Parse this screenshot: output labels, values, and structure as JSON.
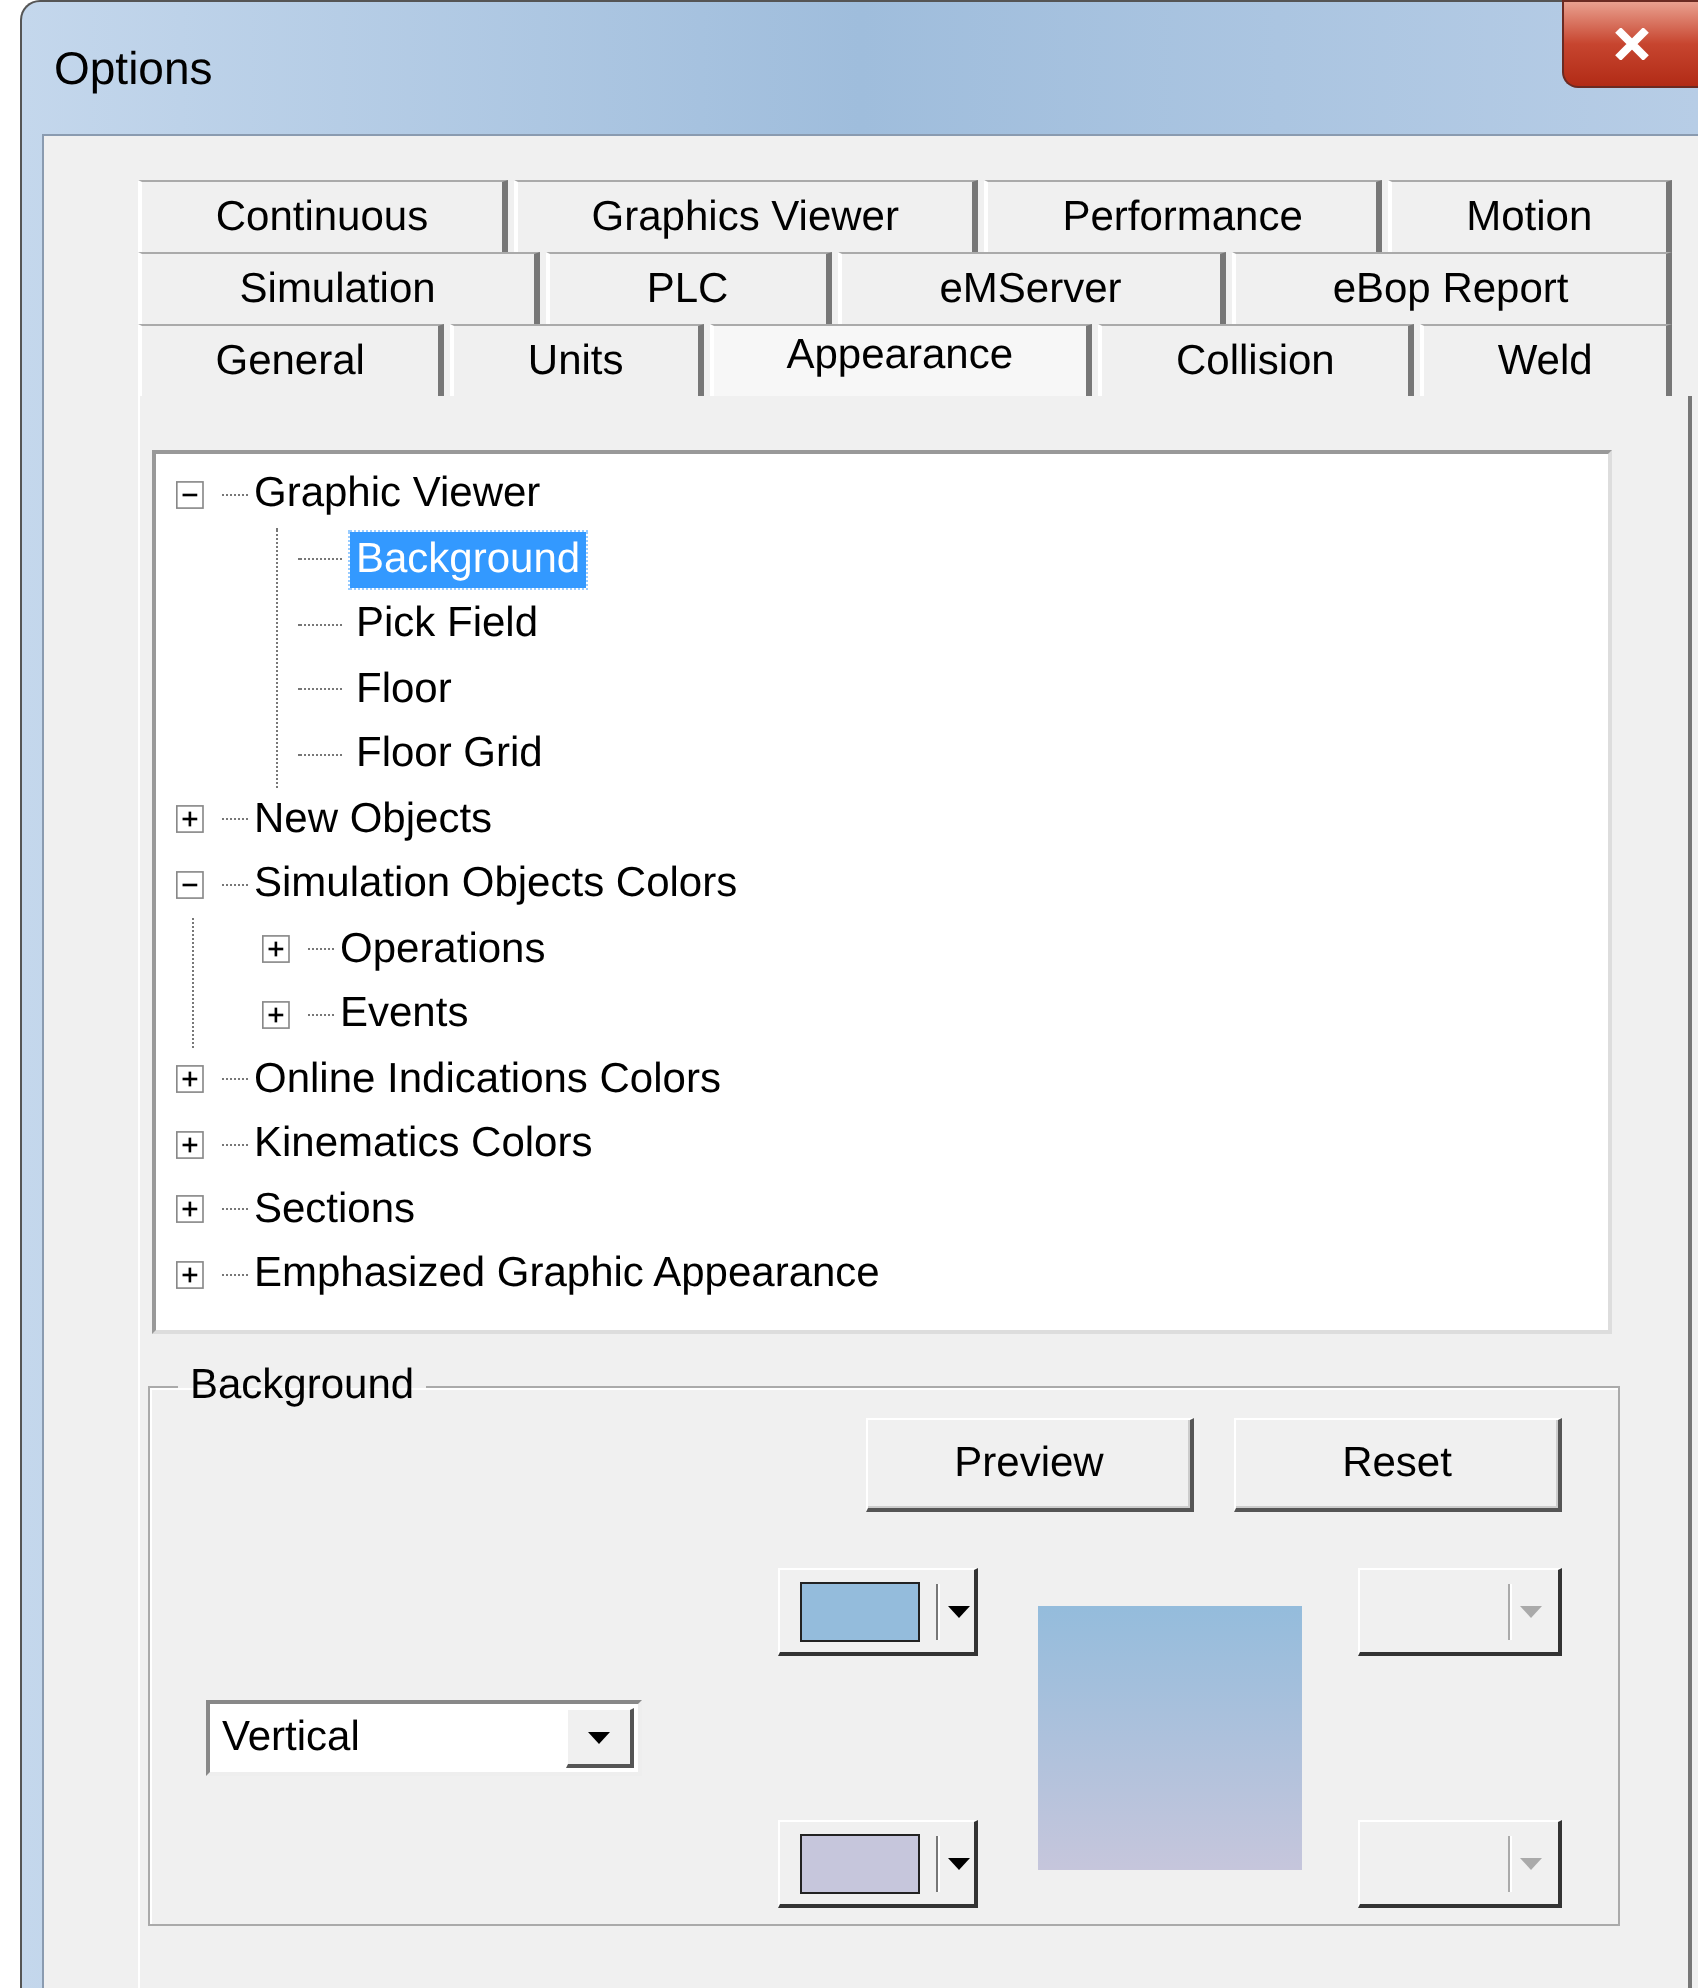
{
  "window": {
    "title": "Options"
  },
  "tab_rows": [
    [
      {
        "label": "Continuous",
        "selected": false
      },
      {
        "label": "Graphics Viewer",
        "selected": false
      },
      {
        "label": "Performance",
        "selected": false
      },
      {
        "label": "Motion",
        "selected": false
      }
    ],
    [
      {
        "label": "Simulation",
        "selected": false
      },
      {
        "label": "PLC",
        "selected": false
      },
      {
        "label": "eMServer",
        "selected": false
      },
      {
        "label": "eBop Report",
        "selected": false
      }
    ],
    [
      {
        "label": "General",
        "selected": false
      },
      {
        "label": "Units",
        "selected": false
      },
      {
        "label": "Appearance",
        "selected": true
      },
      {
        "label": "Collision",
        "selected": false
      },
      {
        "label": "Weld",
        "selected": false
      }
    ]
  ],
  "tree": [
    {
      "label": "Graphic Viewer",
      "expanded": true,
      "selected": false,
      "children": [
        {
          "label": "Background",
          "selected": true
        },
        {
          "label": "Pick Field",
          "selected": false
        },
        {
          "label": "Floor",
          "selected": false
        },
        {
          "label": "Floor Grid",
          "selected": false
        }
      ]
    },
    {
      "label": "New Objects",
      "expanded": false,
      "selected": false
    },
    {
      "label": "Simulation Objects Colors",
      "expanded": true,
      "selected": false,
      "children": [
        {
          "label": "Operations",
          "expanded": false,
          "selected": false
        },
        {
          "label": "Events",
          "expanded": false,
          "selected": false
        }
      ]
    },
    {
      "label": "Online Indications Colors",
      "expanded": false,
      "selected": false
    },
    {
      "label": "Kinematics Colors",
      "expanded": false,
      "selected": false
    },
    {
      "label": "Sections",
      "expanded": false,
      "selected": false
    },
    {
      "label": "Emphasized Graphic Appearance",
      "expanded": false,
      "selected": false
    }
  ],
  "background": {
    "title": "Background",
    "buttons": [
      "Preview",
      "Reset"
    ],
    "direction": {
      "value": "Vertical"
    },
    "color_pickers": [
      {
        "color": "#94bcdc",
        "disabled": false
      },
      {
        "color": "#c6c6dc",
        "disabled": false
      }
    ],
    "secondary_pickers": [
      {
        "disabled": true
      },
      {
        "disabled": true
      }
    ]
  }
}
